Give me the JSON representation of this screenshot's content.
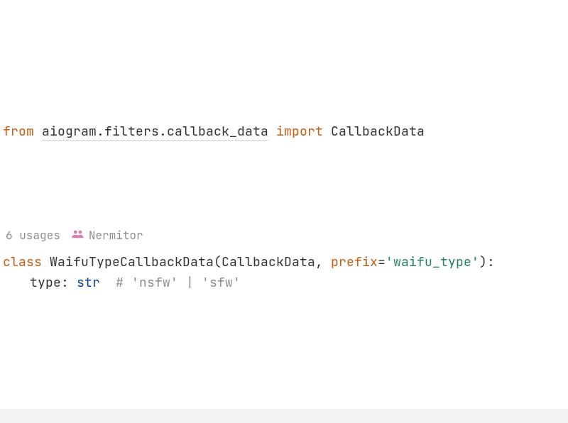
{
  "import_line": {
    "from_kw": "from",
    "module": "aiogram.filters.callback_data",
    "import_kw": "import",
    "name": "CallbackData"
  },
  "hints": {
    "usages": "6 usages",
    "author": "Nermitor"
  },
  "class_line": {
    "class_kw": "class",
    "class_name": "WaifuTypeCallbackData",
    "open_paren": "(",
    "base": "CallbackData",
    "comma": ", ",
    "prefix_name": "prefix",
    "eq": "=",
    "prefix_value": "'waifu_type'",
    "close": "):"
  },
  "body_line": {
    "field": "type",
    "colon": ": ",
    "type": "str",
    "spacer": "  ",
    "comment": "# 'nsfw' | 'sfw'"
  }
}
